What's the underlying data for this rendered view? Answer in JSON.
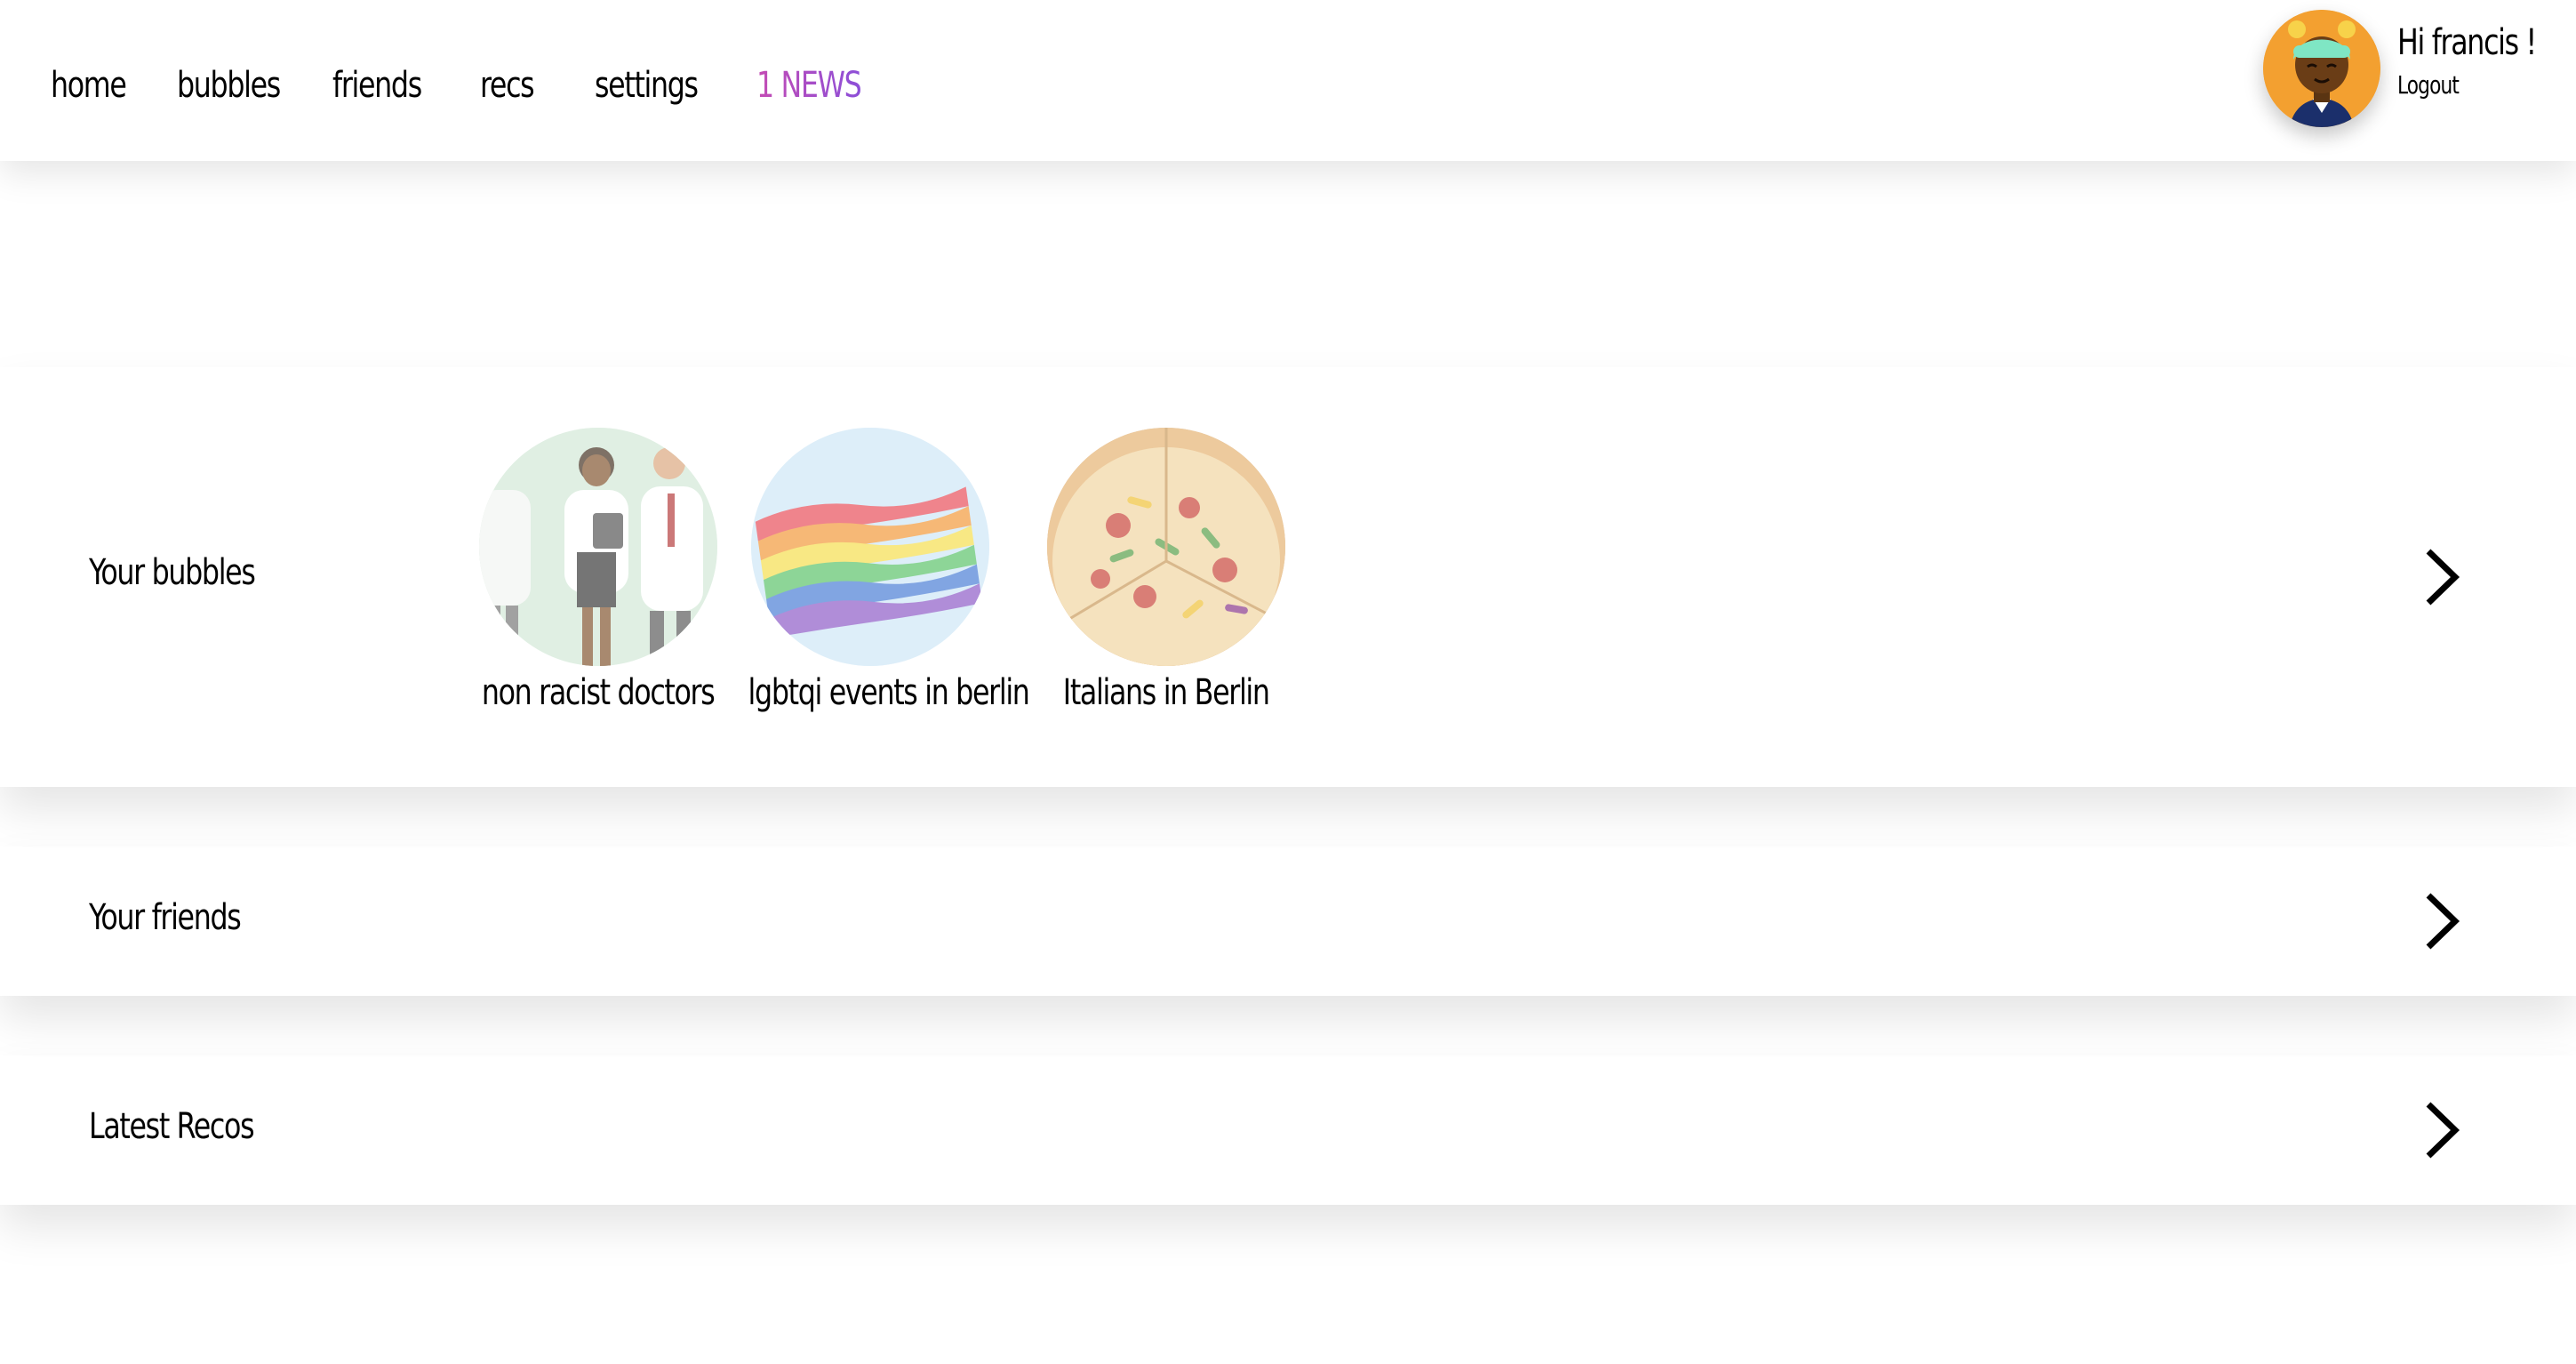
{
  "nav": {
    "items": [
      {
        "label": "home"
      },
      {
        "label": "bubbles"
      },
      {
        "label": "friends"
      },
      {
        "label": "recs"
      },
      {
        "label": "settings"
      },
      {
        "label": "1 NEWS"
      }
    ],
    "news_colors": [
      "#c44bb4",
      "#8d4fd8"
    ]
  },
  "user": {
    "greeting": "Hi francis !",
    "logout_label": "Logout",
    "avatar_icon": "avatar-icon",
    "avatar_bg": "#f3a030"
  },
  "sections": {
    "bubbles": {
      "title": "Your bubbles",
      "items": [
        {
          "label": "non racist doctors",
          "image": "doctors-illustration"
        },
        {
          "label": "lgbtqi events in berlin",
          "image": "rainbow-flag"
        },
        {
          "label": "Italians in Berlin",
          "image": "pizza"
        }
      ]
    },
    "friends": {
      "title": "Your friends"
    },
    "recos": {
      "title": "Latest Recos"
    }
  },
  "icons": {
    "chevron": "chevron-right-icon"
  }
}
